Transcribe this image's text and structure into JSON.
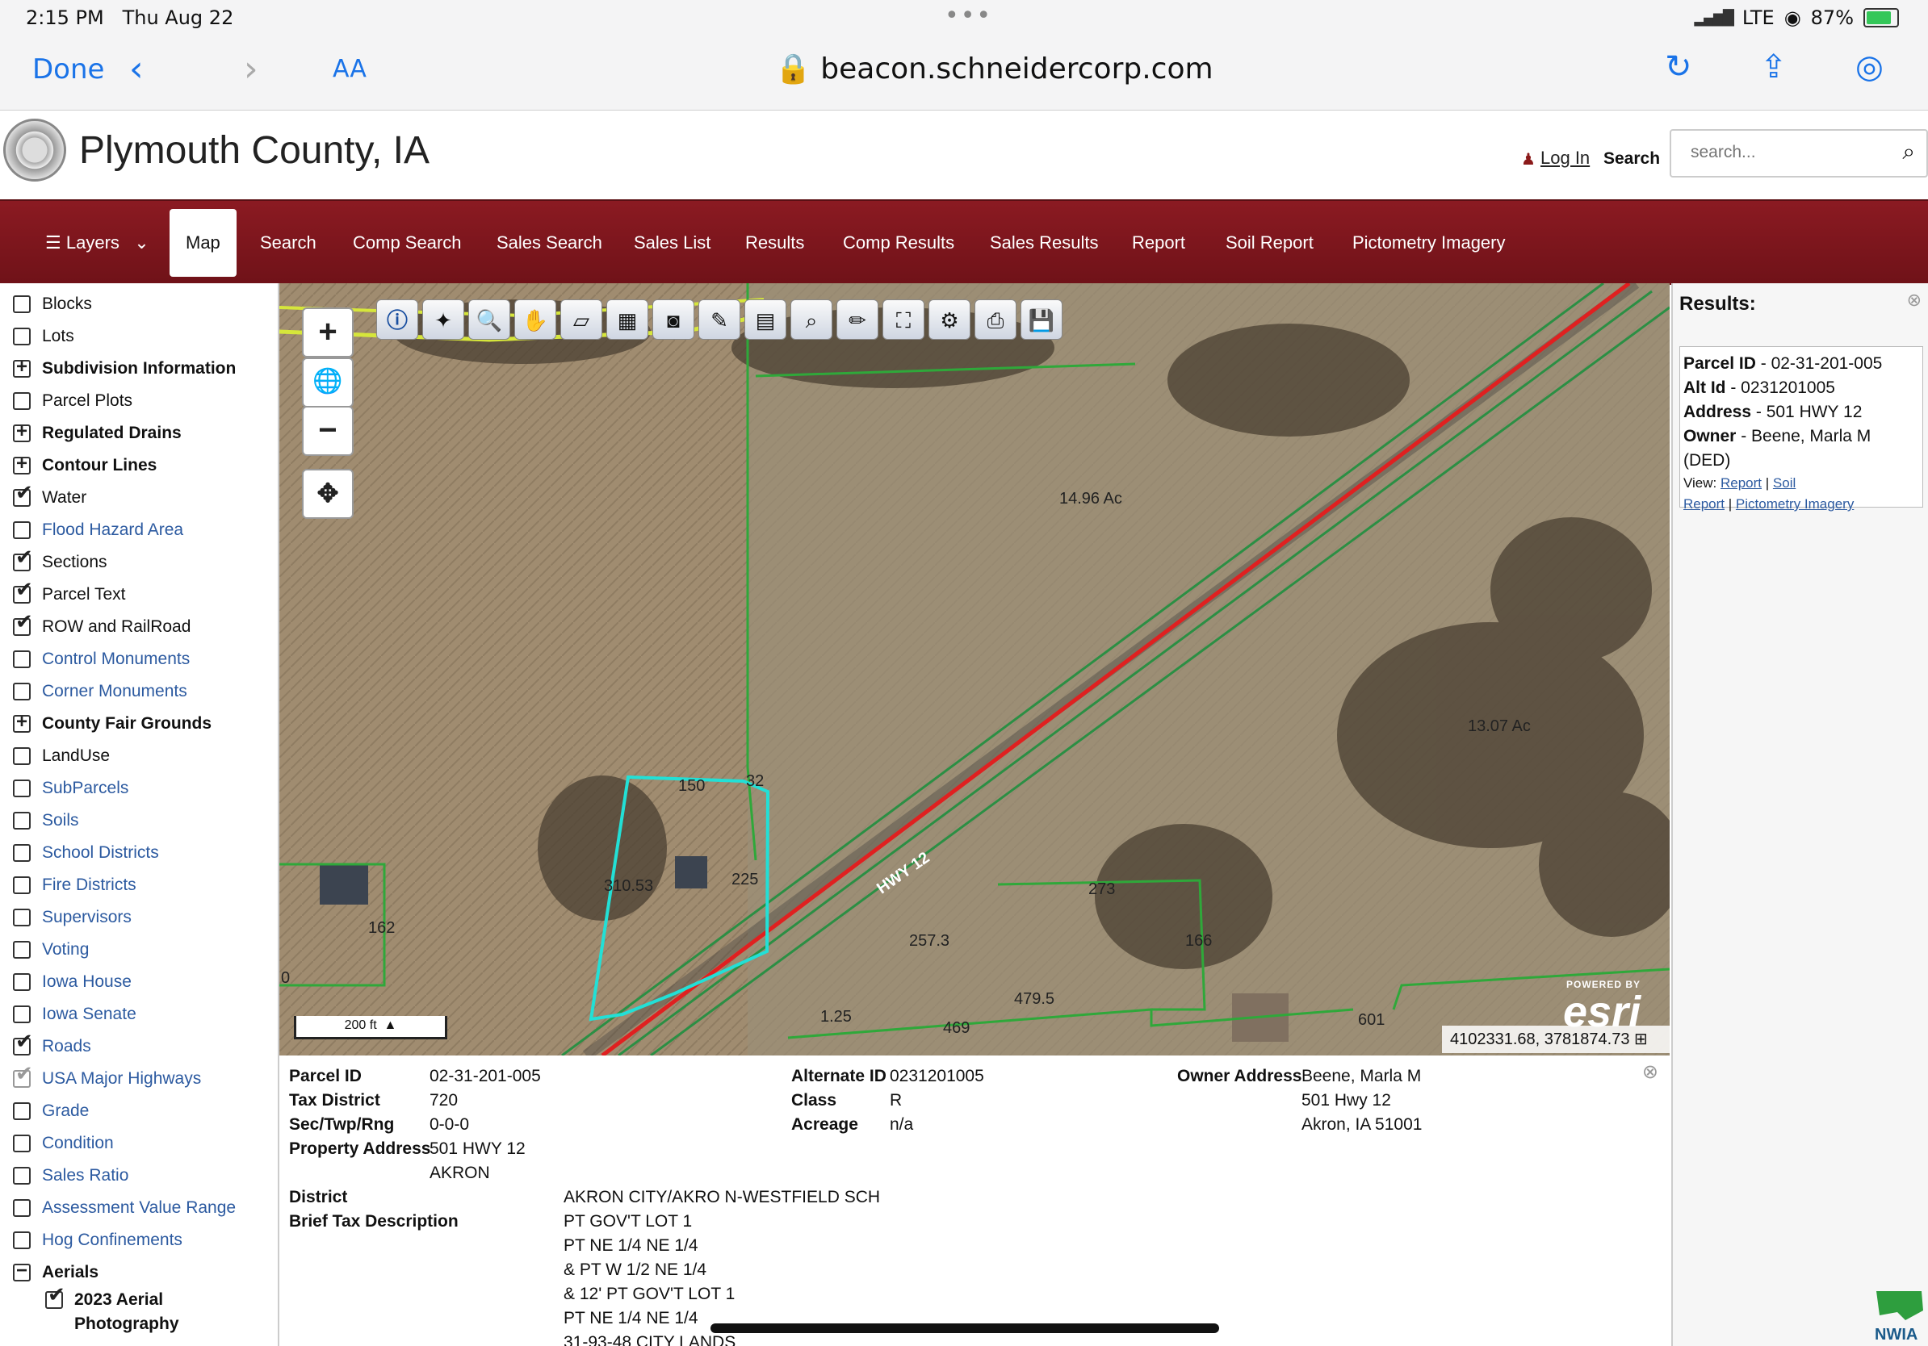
{
  "status_bar": {
    "time": "2:15 PM",
    "date": "Thu Aug 22",
    "network": "LTE",
    "battery": "87%"
  },
  "browser": {
    "done_label": "Done",
    "text_size_label": "AA",
    "url": "beacon.schneidercorp.com"
  },
  "site": {
    "title": "Plymouth County, IA",
    "login_label": "Log In",
    "search_label": "Search",
    "search_placeholder": "search..."
  },
  "nav": {
    "layers_label": "Layers",
    "tabs": [
      "Map",
      "Search",
      "Comp Search",
      "Sales Search",
      "Sales List",
      "Results",
      "Comp Results",
      "Sales Results",
      "Report",
      "Soil Report",
      "Pictometry Imagery"
    ],
    "active_tab": "Map"
  },
  "layers": [
    {
      "label": "Blocks",
      "state": "unchecked",
      "style": "normal"
    },
    {
      "label": "Lots",
      "state": "unchecked",
      "style": "normal"
    },
    {
      "label": "Subdivision Information",
      "state": "expand",
      "style": "bold"
    },
    {
      "label": "Parcel Plots",
      "state": "unchecked",
      "style": "normal"
    },
    {
      "label": "Regulated Drains",
      "state": "expand",
      "style": "bold"
    },
    {
      "label": "Contour Lines",
      "state": "expand",
      "style": "bold"
    },
    {
      "label": "Water",
      "state": "checked",
      "style": "normal"
    },
    {
      "label": "Flood Hazard Area",
      "state": "unchecked",
      "style": "blue"
    },
    {
      "label": "Sections",
      "state": "checked",
      "style": "normal"
    },
    {
      "label": "Parcel Text",
      "state": "checked",
      "style": "normal"
    },
    {
      "label": "ROW and RailRoad",
      "state": "checked",
      "style": "normal"
    },
    {
      "label": "Control Monuments",
      "state": "unchecked",
      "style": "blue"
    },
    {
      "label": "Corner Monuments",
      "state": "unchecked",
      "style": "blue"
    },
    {
      "label": "County Fair Grounds",
      "state": "expand",
      "style": "bold"
    },
    {
      "label": "LandUse",
      "state": "unchecked",
      "style": "normal"
    },
    {
      "label": "SubParcels",
      "state": "unchecked",
      "style": "blue"
    },
    {
      "label": "Soils",
      "state": "unchecked",
      "style": "blue"
    },
    {
      "label": "School Districts",
      "state": "unchecked",
      "style": "blue"
    },
    {
      "label": "Fire Districts",
      "state": "unchecked",
      "style": "blue"
    },
    {
      "label": "Supervisors",
      "state": "unchecked",
      "style": "blue"
    },
    {
      "label": "Voting",
      "state": "unchecked",
      "style": "blue"
    },
    {
      "label": "Iowa House",
      "state": "unchecked",
      "style": "blue"
    },
    {
      "label": "Iowa Senate",
      "state": "unchecked",
      "style": "blue"
    },
    {
      "label": "Roads",
      "state": "checked",
      "style": "blue"
    },
    {
      "label": "USA Major Highways",
      "state": "checked-grey",
      "style": "blue"
    },
    {
      "label": "Grade",
      "state": "unchecked",
      "style": "blue"
    },
    {
      "label": "Condition",
      "state": "unchecked",
      "style": "blue"
    },
    {
      "label": "Sales Ratio",
      "state": "unchecked",
      "style": "blue"
    },
    {
      "label": "Assessment Value Range",
      "state": "unchecked",
      "style": "blue"
    },
    {
      "label": "Hog Confinements",
      "state": "unchecked",
      "style": "blue"
    },
    {
      "label": "Aerials",
      "state": "collapse",
      "style": "bold"
    }
  ],
  "aerial_sublayer": {
    "line1": "2023 Aerial",
    "line2": "Photography"
  },
  "map": {
    "labels": [
      "14.96 Ac",
      "13.07 Ac",
      "HWY 12",
      "32",
      "150",
      "310.53",
      "225",
      "162",
      "257.3",
      "273",
      "166",
      "479.5",
      "469",
      "1.25",
      "601",
      "0"
    ],
    "scale": "200 ft",
    "coordinates": "4102331.68, 3781874.73",
    "esri_powered": "POWERED BY",
    "esri_logo": "esri"
  },
  "results": {
    "header": "Results:",
    "parcel_id_label": "Parcel ID",
    "parcel_id": "02-31-201-005",
    "alt_id_label": "Alt Id",
    "alt_id": "0231201005",
    "address_label": "Address",
    "address": "501 HWY 12",
    "owner_label": "Owner",
    "owner": "Beene, Marla M",
    "owner2": "(DED)",
    "view_label": "View:",
    "link_report": "Report",
    "link_soil": "Soil",
    "link_soil2": "Report",
    "link_pictometry": "Pictometry Imagery"
  },
  "nwia_label": "NWIA",
  "detail": {
    "parcel_id_label": "Parcel ID",
    "parcel_id": "02-31-201-005",
    "tax_district_label": "Tax District",
    "tax_district": "720",
    "sec_label": "Sec/Twp/Rng",
    "sec": "0-0-0",
    "property_address_label": "Property Address",
    "property_address": "501 HWY 12",
    "property_city": "AKRON",
    "alt_id_label": "Alternate ID",
    "alt_id": "0231201005",
    "class_label": "Class",
    "class": "R",
    "acreage_label": "Acreage",
    "acreage": "n/a",
    "owner_address_label": "Owner Address",
    "owner_line1": "Beene, Marla M",
    "owner_line2": "501 Hwy 12",
    "owner_line3": "Akron, IA 51001",
    "district_label": "District",
    "district": "AKRON CITY/AKRO N-WESTFIELD SCH",
    "brief_label": "Brief Tax Description",
    "brief_lines": [
      "PT GOV'T LOT 1",
      "PT NE 1/4 NE 1/4",
      "& PT W 1/2 NE 1/4",
      "& 12' PT GOV'T LOT 1",
      "PT NE 1/4 NE 1/4",
      "31-93-48 CITY LANDS"
    ]
  }
}
